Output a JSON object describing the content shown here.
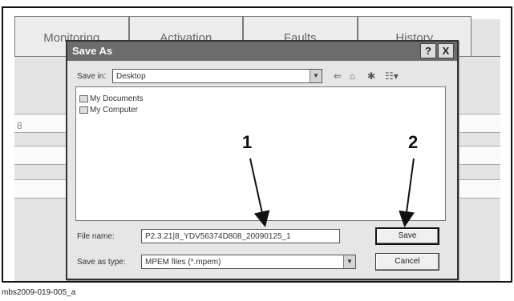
{
  "background_app": {
    "tabs": [
      "Monitoring",
      "Activation",
      "Faults",
      "History"
    ],
    "row_stub": "8"
  },
  "dialog": {
    "title": "Save As",
    "help_button": "?",
    "close_button": "X",
    "save_in_label": "Save in:",
    "save_in_value": "Desktop",
    "toolbar_icons": [
      "back-icon",
      "up-folder-icon",
      "new-folder-icon",
      "view-menu-icon"
    ],
    "files": [
      {
        "name": "My Documents",
        "icon": "documents-folder-icon"
      },
      {
        "name": "My Computer",
        "icon": "computer-icon"
      }
    ],
    "file_name_label": "File name:",
    "file_name_value": "P2.3.21|8_YDV56374D808_20090125_1",
    "save_as_type_label": "Save as type:",
    "save_as_type_value": "MPEM files (*.mpem)",
    "save_button": "Save",
    "cancel_button": "Cancel"
  },
  "callouts": {
    "first": "1",
    "second": "2"
  },
  "caption": "mbs2009-019-005_a"
}
